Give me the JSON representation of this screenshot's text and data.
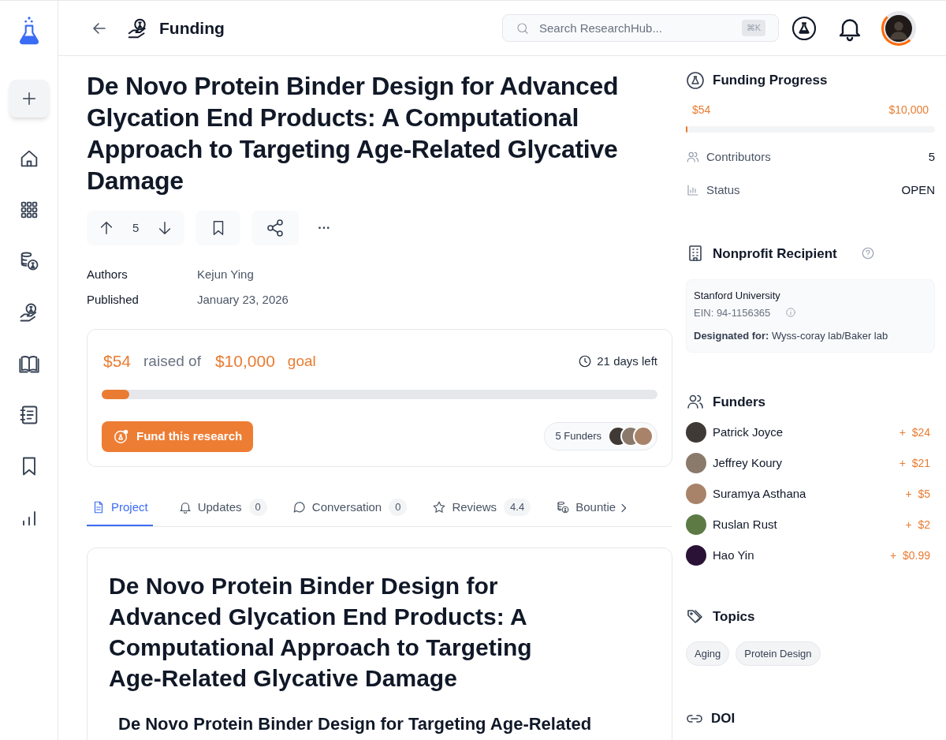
{
  "header": {
    "title": "Funding",
    "search": {
      "placeholder": "Search ResearchHub...",
      "shortcut": "⌘K"
    }
  },
  "project": {
    "title": "De Novo Protein Binder Design for Advanced Glycation End Products: A Computational Approach to Targeting Age-Related Glycative Damage",
    "votes": "5",
    "more": "···",
    "meta": [
      {
        "label": "Authors",
        "value": "Kejun Ying"
      },
      {
        "label": "Published",
        "value": "January 23, 2026"
      }
    ]
  },
  "funding_card": {
    "raised": "$54",
    "raised_label": "raised of",
    "goal": "$10,000",
    "goal_label": "goal",
    "time_left": "21 days left",
    "level": 0.05,
    "button": "Fund this research",
    "funders_label": "5 Funders"
  },
  "tabs": [
    {
      "label": "Project",
      "selected": true
    },
    {
      "label": "Updates",
      "count": "0",
      "selected": false
    },
    {
      "label": "Conversation",
      "count": "0",
      "selected": false
    },
    {
      "label": "Reviews",
      "count": "4.4",
      "selected": false
    },
    {
      "label": "Bountie",
      "selected": false
    }
  ],
  "document": {
    "heading": "De Novo Protein Binder Design for Advanced Glycation End Products: A Computational Approach to Targeting Age-Related Glycative Damage",
    "subheading": "De Novo Protein Binder Design for Targeting Age-Related"
  },
  "funding_progress": {
    "title": "Funding Progress",
    "raised": "$54",
    "goal": "$10,000",
    "level": 0.006,
    "stats": [
      {
        "label": "Contributors",
        "value": "5"
      },
      {
        "label": "Status",
        "value": "OPEN"
      }
    ]
  },
  "nonprofit": {
    "title": "Nonprofit Recipient",
    "name": "Stanford University",
    "ein": "EIN: 94-1156365",
    "designated": "**Designated for:** Wyss-coray lab/Baker lab"
  },
  "funders": {
    "title": "Funders",
    "items": [
      {
        "name": "Patrick Joyce",
        "amount": "+  $24",
        "color": "#3f3a36"
      },
      {
        "name": "Jeffrey Koury",
        "amount": "+  $21",
        "color": "#8a7a6c"
      },
      {
        "name": "Suramya Asthana",
        "amount": "+  $5",
        "color": "#a8836a"
      },
      {
        "name": "Ruslan Rust",
        "amount": "+  $2",
        "color": "#5d7a45"
      },
      {
        "name": "Hao Yin",
        "amount": "+  $0.99",
        "color": "#2a1236"
      }
    ]
  },
  "topics": {
    "title": "Topics",
    "items": [
      "Aging",
      "Protein Design"
    ]
  },
  "doi": {
    "title": "DOI"
  }
}
